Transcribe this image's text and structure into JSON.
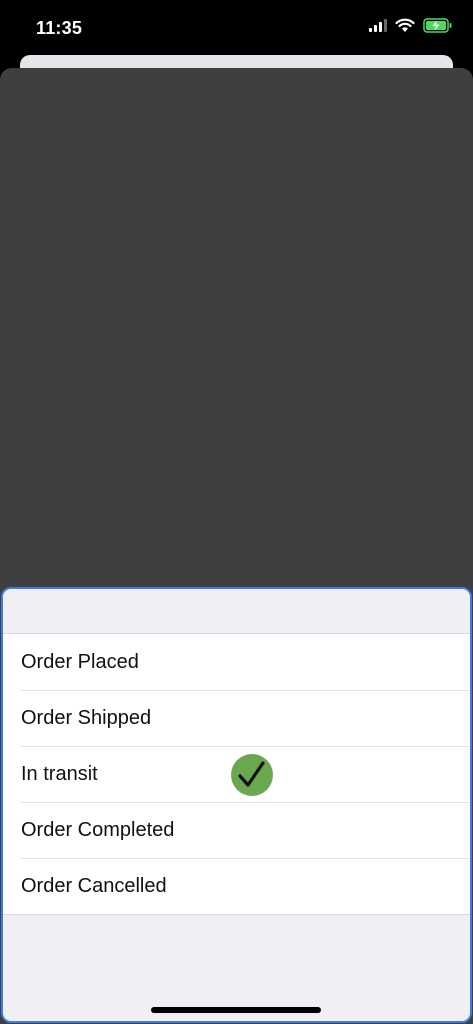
{
  "status_bar": {
    "time": "11:35",
    "signal_icon": "cellular-signal-icon",
    "wifi_icon": "wifi-icon",
    "battery_icon": "battery-charging-icon",
    "battery_color": "#4cd964"
  },
  "background": {
    "card_color": "#3f3f3f"
  },
  "sheet": {
    "accent_border": "#3b7de0",
    "options": [
      {
        "label": "Order Placed",
        "selected": false
      },
      {
        "label": "Order Shipped",
        "selected": false
      },
      {
        "label": "In transit",
        "selected": true
      },
      {
        "label": "Order Completed",
        "selected": false
      },
      {
        "label": "Order Cancelled",
        "selected": false
      }
    ],
    "selected_icon": "checkmark-circle-icon",
    "selected_icon_color": "#6aa84f"
  }
}
